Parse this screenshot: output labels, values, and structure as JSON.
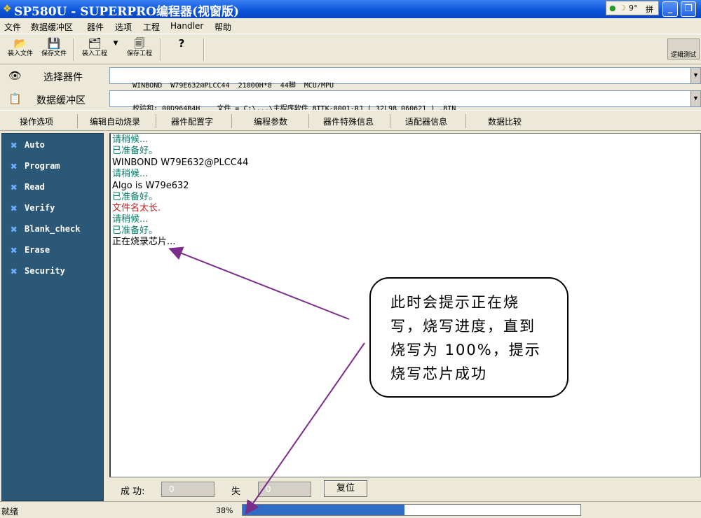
{
  "window": {
    "title": "SP580U - SUPERPRO编程器(视窗版)",
    "ime_label": "拼",
    "ime_extra": "9°",
    "minimize_glyph": "_",
    "restore_glyph": "❐"
  },
  "menu": [
    "文件",
    "数据缓冲区",
    "器件",
    "选项",
    "工程",
    "Handler",
    "帮助"
  ],
  "toolbar": {
    "load_file": "装入文件",
    "save_file": "保存文件",
    "load_project": "装入工程",
    "save_project": "保存工程",
    "help_glyph": "?",
    "logic_test": "逻辑测试"
  },
  "device_row": {
    "label": "选择器件",
    "value": "WINBOND  W79E632@PLCC44  21000H*8  44脚  MCU/MPU"
  },
  "buffer_row": {
    "label": "数据缓冲区",
    "value": "校验和: 00D964B4H    文件 = C:\\...\\主程序软件 8TTK-0001-RJ ( 32L98_060621 ) .BIN"
  },
  "tabs": [
    "操作选项",
    "编辑自动烧录",
    "器件配置字",
    "编程参数",
    "器件特殊信息",
    "适配器信息",
    "数据比较"
  ],
  "side_menu": [
    "Auto",
    "Program",
    "Read",
    "Verify",
    "Blank_check",
    "Erase",
    "Security"
  ],
  "log": [
    {
      "text": "请稍候...",
      "color": "green"
    },
    {
      "text": "已准备好。",
      "color": "green"
    },
    {
      "text": "WINBOND W79E632@PLCC44",
      "color": "black"
    },
    {
      "text": "请稍候...",
      "color": "green"
    },
    {
      "text": "Algo is W79e632",
      "color": "black"
    },
    {
      "text": "已准备好。",
      "color": "green"
    },
    {
      "text": "文件名太长.",
      "color": "red"
    },
    {
      "text": "请稍候...",
      "color": "green"
    },
    {
      "text": "已准备好。",
      "color": "green"
    },
    {
      "text": "正在烧录芯片...",
      "color": "black"
    }
  ],
  "bottom": {
    "success_label": "成 功:",
    "success_value": "0",
    "fail_label": "失",
    "fail_value": "0",
    "reset_label": "复位"
  },
  "status": {
    "text": "就绪",
    "percent_text": "38%",
    "progress": 0.48
  },
  "annotation": {
    "lines": [
      "此时会提示正在烧",
      "写，烧写进度，直到",
      "烧写为 100%，提示",
      "烧写芯片成功"
    ]
  },
  "colors": {
    "log_green": "#0a7a6a",
    "log_red": "#c02020",
    "side_panel": "#2c5878",
    "progress": "#2f6cc6",
    "arrow": "#7a2d8a"
  }
}
